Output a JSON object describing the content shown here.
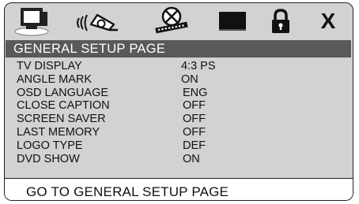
{
  "toolbar": {
    "icons": [
      {
        "name": "general-setup-icon",
        "selected": true
      },
      {
        "name": "audio-setup-icon",
        "selected": false
      },
      {
        "name": "video-setup-icon",
        "selected": false
      },
      {
        "name": "display-setup-icon",
        "selected": false
      },
      {
        "name": "lock-icon",
        "selected": false
      },
      {
        "name": "exit-icon",
        "label": "X",
        "selected": false
      }
    ]
  },
  "menu": {
    "title": "GENERAL SETUP PAGE",
    "items": [
      {
        "label": "TV DISPLAY",
        "value": "4:3 PS"
      },
      {
        "label": "ANGLE MARK",
        "value": "ON"
      },
      {
        "label": "OSD LANGUAGE",
        "value": "ENG"
      },
      {
        "label": "CLOSE CAPTION",
        "value": "OFF"
      },
      {
        "label": "SCREEN SAVER",
        "value": "OFF"
      },
      {
        "label": "LAST MEMORY",
        "value": "OFF"
      },
      {
        "label": "LOGO TYPE",
        "value": "DEF"
      },
      {
        "label": "DVD SHOW",
        "value": "ON"
      }
    ]
  },
  "footer": {
    "hint": "GO TO GENERAL SETUP PAGE"
  },
  "colors": {
    "panel": "#d2d2d2",
    "title_bar": "#595959",
    "text": "#111111",
    "footer_bg": "#ffffff"
  }
}
